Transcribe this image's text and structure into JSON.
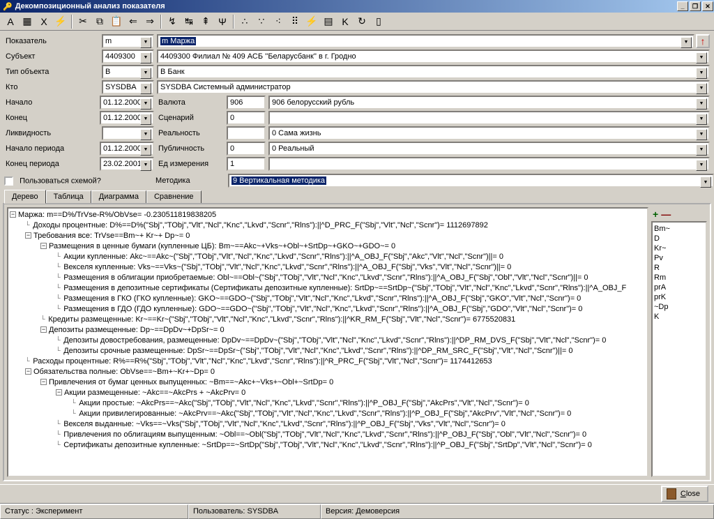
{
  "window_title": "Декомпозиционный анализ показателя",
  "winbtns": {
    "min": "_",
    "max": "❐",
    "close": "✕"
  },
  "toolbar": [
    {
      "n": "font-icon",
      "g": "A"
    },
    {
      "n": "calculator-icon",
      "g": "▦"
    },
    {
      "n": "excel-icon",
      "g": "X"
    },
    {
      "n": "zap-icon",
      "g": "⚡"
    },
    {
      "n": "sep"
    },
    {
      "n": "cut-icon",
      "g": "✂"
    },
    {
      "n": "copy-icon",
      "g": "⧉"
    },
    {
      "n": "paste-icon",
      "g": "📋"
    },
    {
      "n": "back-icon",
      "g": "⇐"
    },
    {
      "n": "forward-icon",
      "g": "⇒"
    },
    {
      "n": "sep"
    },
    {
      "n": "tree1-icon",
      "g": "↯"
    },
    {
      "n": "tree2-icon",
      "g": "↹"
    },
    {
      "n": "tree3-icon",
      "g": "⇞"
    },
    {
      "n": "fork-icon",
      "g": "Ψ"
    },
    {
      "n": "sep"
    },
    {
      "n": "dots1-icon",
      "g": "∴"
    },
    {
      "n": "dots2-icon",
      "g": "∵"
    },
    {
      "n": "dots3-icon",
      "g": "⁖"
    },
    {
      "n": "dots4-icon",
      "g": "⠿"
    },
    {
      "n": "bolt-icon",
      "g": "⚡"
    },
    {
      "n": "calendar-icon",
      "g": "▤"
    },
    {
      "n": "k-icon",
      "g": "K"
    },
    {
      "n": "refresh-icon",
      "g": "↻"
    },
    {
      "n": "film-icon",
      "g": "▯"
    }
  ],
  "form": {
    "left": [
      {
        "label": "Показатель",
        "value": "m"
      },
      {
        "label": "Субъект",
        "value": "4409300"
      },
      {
        "label": "Тип объекта",
        "value": "B"
      },
      {
        "label": "Кто",
        "value": "SYSDBA"
      },
      {
        "label": "Начало",
        "value": "01.12.2000"
      },
      {
        "label": "Конец",
        "value": "01.12.2000"
      },
      {
        "label": "Ликвидность",
        "value": ""
      },
      {
        "label": "Начало периода",
        "value": "01.12.2000"
      },
      {
        "label": "Конец периода",
        "value": "23.02.2001"
      }
    ],
    "right_top": [
      {
        "kind": "full",
        "value": "m Маржа",
        "highlight": true,
        "hasArrow": true
      },
      {
        "kind": "full",
        "value": "4409300 Филиал № 409 АСБ ''Беларусбанк'' в г. Гродно"
      },
      {
        "kind": "full",
        "value": "B Банк"
      },
      {
        "kind": "full",
        "value": "SYSDBA Системный администратор"
      }
    ],
    "right_split": [
      {
        "label": "Валюта",
        "code": "906",
        "text": "906 белорусский рубль"
      },
      {
        "label": "Сценарий",
        "code": "0",
        "text": ""
      },
      {
        "label": "Реальность",
        "code": "",
        "text": "0 Сама жизнь"
      },
      {
        "label": "Публичность",
        "code": "0",
        "text": "0 Реальный"
      },
      {
        "label": "Ед измерения",
        "code": "1",
        "text": ""
      }
    ],
    "scheme_label": "Пользоваться схемой?",
    "methodika_label": "Методика",
    "methodika_value": "9 Вертикальная методика"
  },
  "tabs": [
    "Дерево",
    "Таблица",
    "Диаграмма",
    "Сравнение"
  ],
  "active_tab": 0,
  "side": {
    "plus": "+",
    "minus": "—",
    "items": [
      "Bm~",
      "D",
      "Kr~",
      "Pv",
      "R",
      "Rm",
      "prA",
      "prK",
      "~Dp",
      "K"
    ]
  },
  "tree": [
    {
      "d": 0,
      "box": "-",
      "t": "Маржа: m==D%/TrVse-R%/ObVse= -0.230511819838205"
    },
    {
      "d": 1,
      "box": "",
      "t": "Доходы процентные: D%==D%(''Sbj'',''TObj'',''Vlt'',''Ncl'',''Knc'',''Lkvd'',''Scnr'',''Rlns''):||^D_PRC_F(''Sbj'',''Vlt'',''Ncl'',''Scnr'')= 1112697892"
    },
    {
      "d": 1,
      "box": "-",
      "t": "Требования все: TrVse==Bm~+  Kr~+  Dp~= 0"
    },
    {
      "d": 2,
      "box": "-",
      "t": "Размещения в ценные бумаги (купленные ЦБ): Bm~==Akc~+Vks~+Obl~+SrtDp~+GKO~+GDO~= 0"
    },
    {
      "d": 3,
      "box": "",
      "t": "Акции купленные: Akc~==Akc~(''Sbj'',''TObj'',''Vlt'',''Ncl'',''Knc'',''Lkvd'',''Scnr'',''Rlns''):||^A_OBJ_F(''Sbj'',''Akc'',''Vlt'',''Ncl'',''Scnr'')||= 0"
    },
    {
      "d": 3,
      "box": "",
      "t": "Векселя купленные: Vks~==Vks~(''Sbj'',''TObj'',''Vlt'',''Ncl'',''Knc'',''Lkvd'',''Scnr'',''Rlns''):||^A_OBJ_F(''Sbj'',''Vks'',''Vlt'',''Ncl'',''Scnr'')||= 0"
    },
    {
      "d": 3,
      "box": "",
      "t": "Размещения в облигации приобретаемые: Obl~==Obl~(''Sbj'',''TObj'',''Vlt'',''Ncl'',''Knc'',''Lkvd'',''Scnr'',''Rlns''):||^A_OBJ_F(''Sbj'',''Obl'',''Vlt'',''Ncl'',''Scnr'')||= 0"
    },
    {
      "d": 3,
      "box": "",
      "t": "Размещения в депозитные сертификаты (Сертификаты депозитные купленные): SrtDp~==SrtDp~(''Sbj'',''TObj'',''Vlt'',''Ncl'',''Knc'',''Lkvd'',''Scnr'',''Rlns''):||^A_OBJ_F"
    },
    {
      "d": 3,
      "box": "",
      "t": "Размещения в ГКО (ГКО купленные): GKO~==GDO~(''Sbj'',''TObj'',''Vlt'',''Ncl'',''Knc'',''Lkvd'',''Scnr'',''Rlns''):||^A_OBJ_F(''Sbj'',''GKO'',''Vlt'',''Ncl'',''Scnr'')= 0"
    },
    {
      "d": 3,
      "box": "",
      "t": "Размещения в ГДО (ГДО купленные): GDO~==GDO~(''Sbj'',''TObj'',''Vlt'',''Ncl'',''Knc'',''Lkvd'',''Scnr'',''Rlns''):||^A_OBJ_F(''Sbj'',''GDO'',''Vlt'',''Ncl'',''Scnr'')= 0"
    },
    {
      "d": 2,
      "box": "",
      "t": "Кредиты размещенные: Kr~==Kr~(''Sbj'',''TObj'',''Vlt'',''Ncl'',''Knc'',''Lkvd'',''Scnr'',''Rlns''):||^KR_RM_F(''Sbj'',''Vlt'',''Ncl'',''Scnr'')= 6775520831"
    },
    {
      "d": 2,
      "box": "-",
      "t": "Депозиты размещенные: Dp~==DpDv~+DpSr~= 0"
    },
    {
      "d": 3,
      "box": "",
      "t": "Депозиты довострeбования, размещенные: DpDv~==DpDv~(''Sbj'',''TObj'',''Vlt'',''Ncl'',''Knc'',''Lkvd'',''Scnr'',''Rlns''):||^DP_RM_DVS_F(''Sbj'',''Vlt'',''Ncl'',''Scnr'')= 0"
    },
    {
      "d": 3,
      "box": "",
      "t": "Депозиты срочные размещенные: DpSr~==DpSr~(''Sbj'',''TObj'',''Vlt'',''Ncl'',''Knc'',''Lkvd'',''Scnr'',''Rlns''):||^DP_RM_SRC_F(''Sbj'',''Vlt'',''Ncl'',''Scnr'')||= 0"
    },
    {
      "d": 1,
      "box": "",
      "t": "Расходы процентные: R%==R%(''Sbj'',''TObj'',''Vlt'',''Ncl'',''Knc'',''Lkvd'',''Scnr'',''Rlns''):||^R_PRC_F(''Sbj'',''Vlt'',''Ncl'',''Scnr'')= 1174412653"
    },
    {
      "d": 1,
      "box": "-",
      "t": "Обязательства полные: ObVse==~Bm+~Kr+~Dp= 0"
    },
    {
      "d": 2,
      "box": "-",
      "t": "Привлечения от бумаг ценных  выпущенных: ~Bm==~Akc+~Vks+~Obl+~SrtDp= 0"
    },
    {
      "d": 3,
      "box": "-",
      "t": "Акции размещенные: ~Akc==~AkcPrs + ~AkcPrv= 0"
    },
    {
      "d": 4,
      "box": "",
      "t": "Акции простые: ~AkcPrs==~Akc(''Sbj'',''TObj'',''Vlt'',''Ncl'',''Knc'',''Lkvd'',''Scnr'',''Rlns''):||^P_OBJ_F(''Sbj'',''AkcPrs'',''Vlt'',''Ncl'',''Scnr'')= 0"
    },
    {
      "d": 4,
      "box": "",
      "t": "Акции привилегированные: ~AkcPrv==~Akc(''Sbj'',''TObj'',''Vlt'',''Ncl'',''Knc'',''Lkvd'',''Scnr'',''Rlns''):||^P_OBJ_F(''Sbj'',''AkcPrv'',''Vlt'',''Ncl'',''Scnr'')= 0"
    },
    {
      "d": 3,
      "box": "",
      "t": "Векселя выданные: ~Vks==~Vks(''Sbj'',''TObj'',''Vlt'',''Ncl'',''Knc'',''Lkvd'',''Scnr'',''Rlns''):||^P_OBJ_F(''Sbj'',''Vks'',''Vlt'',''Ncl'',''Scnr'')= 0"
    },
    {
      "d": 3,
      "box": "",
      "t": "Привлечения по облигациям выпущенным: ~Obl==~Obl(''Sbj'',''TObj'',''Vlt'',''Ncl'',''Knc'',''Lkvd'',''Scnr'',''Rlns''):||^P_OBJ_F(''Sbj'',''Obl'',''Vlt'',''Ncl'',''Scnr'')= 0"
    },
    {
      "d": 3,
      "box": "",
      "t": "Сертификаты депозитные купленные: ~SrtDp==~SrtDp(''Sbj'',''TObj'',''Vlt'',''Ncl'',''Knc'',''Lkvd'',''Scnr'',''Rlns''):||^P_OBJ_F(''Sbj'',''SrtDp'',''Vlt'',''Ncl'',''Scnr'')= 0"
    }
  ],
  "close_label": "Close",
  "status": {
    "left": "Статус  : Эксперимент",
    "mid": "Пользователь: SYSDBA",
    "right": "Версия:  Демоверсия"
  }
}
